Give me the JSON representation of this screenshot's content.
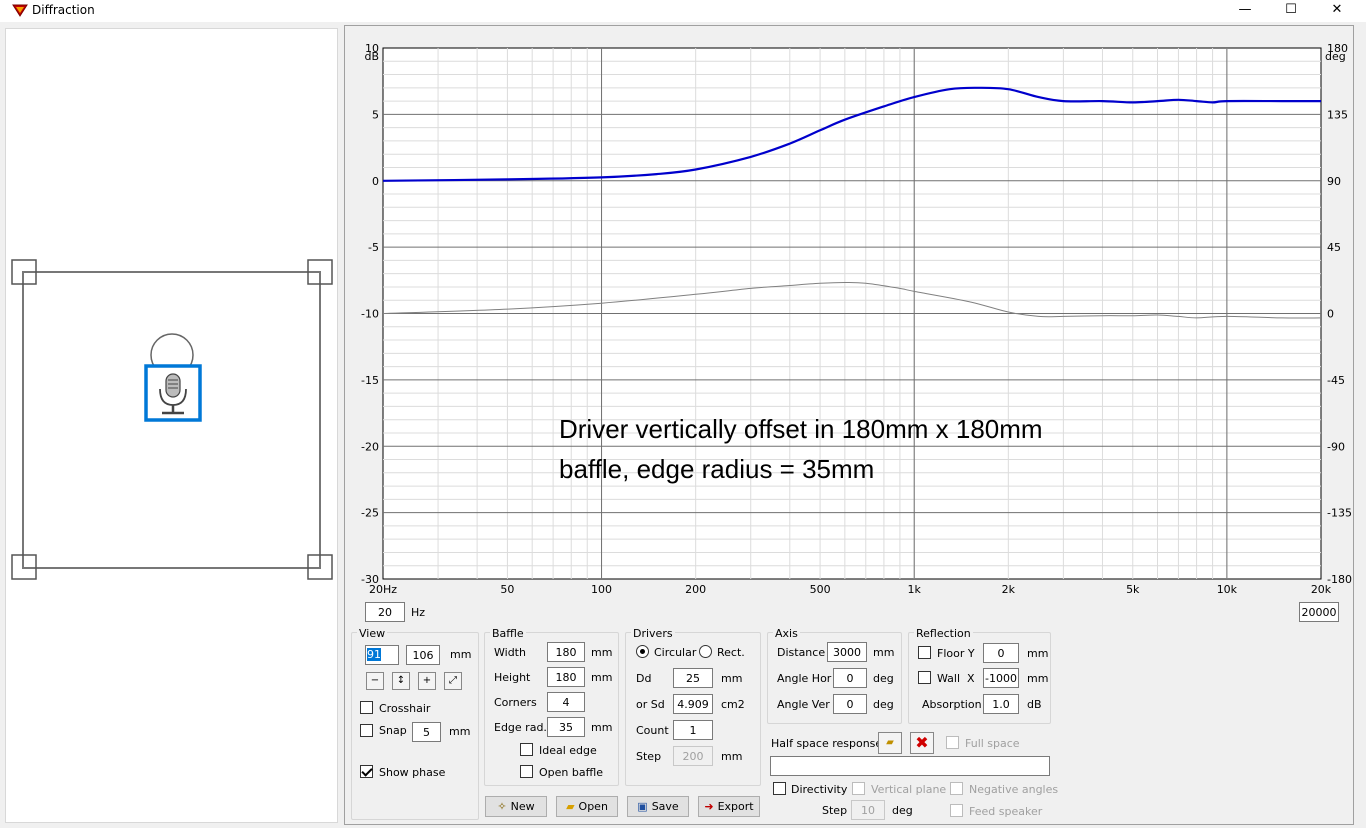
{
  "window": {
    "title": "Diffraction",
    "minimize_glyph": "—",
    "maximize_glyph": "☐",
    "close_glyph": "✕",
    "icon": "app-logo-icon"
  },
  "chart_data": {
    "type": "line",
    "annotation": [
      "Driver vertically offset in 180mm x 180mm",
      "baffle, edge radius = 35mm"
    ],
    "x_scale": "log",
    "xlim": [
      20,
      20000
    ],
    "x_ticks": [
      {
        "v": 20,
        "label": "20Hz"
      },
      {
        "v": 50,
        "label": "50"
      },
      {
        "v": 100,
        "label": "100"
      },
      {
        "v": 200,
        "label": "200"
      },
      {
        "v": 500,
        "label": "500"
      },
      {
        "v": 1000,
        "label": "1k"
      },
      {
        "v": 2000,
        "label": "2k"
      },
      {
        "v": 5000,
        "label": "5k"
      },
      {
        "v": 10000,
        "label": "10k"
      },
      {
        "v": 20000,
        "label": "20k"
      }
    ],
    "ylim": [
      -30,
      10
    ],
    "y_ticks": [
      10,
      5,
      0,
      -5,
      -10,
      -15,
      -20,
      -25,
      -30
    ],
    "y_unit": "dB",
    "y2lim": [
      -180,
      180
    ],
    "y2_ticks": [
      180,
      135,
      90,
      45,
      0,
      -45,
      -90,
      -135,
      -180
    ],
    "y2_unit": "deg",
    "grid": true,
    "series": [
      {
        "axis": "left",
        "color": "#0000cc",
        "x": [
          20,
          50,
          100,
          150,
          200,
          300,
          400,
          500,
          600,
          800,
          1000,
          1300,
          1600,
          2000,
          2500,
          3000,
          4000,
          5000,
          6000,
          7000,
          8000,
          9000,
          10000,
          15000,
          20000
        ],
        "y": [
          0.0,
          0.1,
          0.25,
          0.5,
          0.85,
          1.8,
          2.8,
          3.8,
          4.6,
          5.6,
          6.3,
          6.9,
          7.0,
          6.9,
          6.3,
          6.0,
          6.0,
          5.9,
          6.0,
          6.1,
          6.0,
          5.9,
          6.0,
          6.0,
          6.0
        ]
      },
      {
        "axis": "right",
        "color": "#808080",
        "x": [
          20,
          50,
          100,
          200,
          300,
          400,
          500,
          600,
          700,
          900,
          1000,
          1500,
          2000,
          2500,
          3000,
          4000,
          5000,
          6000,
          7000,
          8000,
          10000,
          15000,
          20000
        ],
        "y": [
          0,
          3,
          7,
          13,
          17,
          19,
          20.5,
          21,
          20.5,
          17,
          15,
          8,
          1,
          -2,
          -2,
          -1.5,
          -1.5,
          -1,
          -2,
          -3,
          -2,
          -3,
          -3
        ]
      }
    ]
  },
  "freq_range": {
    "min": "20",
    "max": "20000",
    "unit": "Hz"
  },
  "view": {
    "label": "View",
    "val1": "91",
    "val2": "106",
    "unit": "mm",
    "crosshair_label": "Crosshair",
    "snap_label": "Snap",
    "snap_val": "5",
    "snap_unit": "mm",
    "show_phase_label": "Show phase"
  },
  "baffle": {
    "label": "Baffle",
    "width_label": "Width",
    "width": "180",
    "width_unit": "mm",
    "height_label": "Height",
    "height": "180",
    "height_unit": "mm",
    "corners_label": "Corners",
    "corners": "4",
    "edge_label": "Edge rad.",
    "edge": "35",
    "edge_unit": "mm",
    "ideal_label": "Ideal edge",
    "open_label": "Open baffle"
  },
  "drivers": {
    "label": "Drivers",
    "circular_label": "Circular",
    "rect_label": "Rect.",
    "dd_label": "Dd",
    "dd": "25",
    "dd_unit": "mm",
    "sd_label": "or Sd",
    "sd": "4.909",
    "sd_unit": "cm2",
    "count_label": "Count",
    "count": "1",
    "step_label": "Step",
    "step": "200",
    "step_unit": "mm"
  },
  "axis": {
    "label": "Axis",
    "distance_label": "Distance",
    "distance": "3000",
    "distance_unit": "mm",
    "hor_label": "Angle Hor",
    "hor": "0",
    "hor_unit": "deg",
    "ver_label": "Angle Ver",
    "ver": "0",
    "ver_unit": "deg"
  },
  "reflection": {
    "label": "Reflection",
    "floor_label": "Floor Y",
    "floor": "0",
    "floor_unit": "mm",
    "wall_label": "Wall  X",
    "wall": "-1000",
    "wall_unit": "mm",
    "absorption_label": "Absorption",
    "absorption": "1.0",
    "absorption_unit": "dB"
  },
  "halfspace": {
    "label": "Half space response",
    "full_space_label": "Full space",
    "path": "",
    "directivity_label": "Directivity",
    "vertical_label": "Vertical plane",
    "negative_label": "Negative angles",
    "step_label": "Step",
    "step": "10",
    "step_unit": "deg",
    "feed_label": "Feed speaker"
  },
  "buttons": {
    "new": "New",
    "open": "Open",
    "save": "Save",
    "export": "Export"
  },
  "colors": {
    "accent": "#0078d7",
    "trace": "#0000cc",
    "phase": "#808080"
  }
}
